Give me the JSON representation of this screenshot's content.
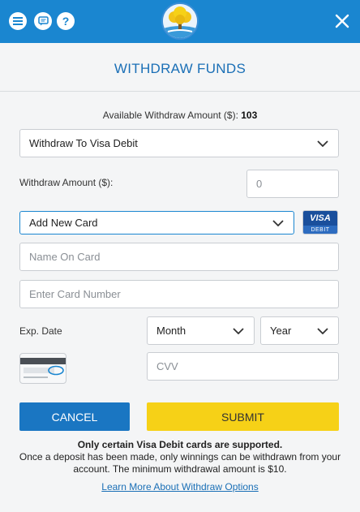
{
  "header": {
    "menu_icon": "menu-icon",
    "chat_icon": "chat-icon",
    "help_icon": "help-icon",
    "help_glyph": "?",
    "logo_icon": "tree-logo-icon",
    "close_icon": "close-icon"
  },
  "dialog": {
    "title": "WITHDRAW FUNDS",
    "available_label": "Available Withdraw Amount ($): ",
    "available_value": "103",
    "method_select": "Withdraw To Visa Debit",
    "amount_label": "Withdraw Amount ($):",
    "amount_placeholder": "0",
    "card_select": "Add New Card",
    "visa_badge_top": "VISA",
    "visa_badge_bottom": "DEBIT",
    "name_placeholder": "Name On Card",
    "card_number_placeholder": "Enter Card Number",
    "exp_label": "Exp. Date",
    "month_select": "Month",
    "year_select": "Year",
    "cvv_placeholder": "CVV",
    "cancel_label": "CANCEL",
    "submit_label": "SUBMIT",
    "notice_bold": "Only certain Visa Debit cards are supported.",
    "notice_text": "Once a deposit has been made, only winnings can be withdrawn from your account. The minimum withdrawal amount is $10.",
    "learn_more": "Learn More About Withdraw Options"
  },
  "colors": {
    "header_blue": "#1a86d0",
    "title_blue": "#1a6fb6",
    "cancel_blue": "#1a76c2",
    "submit_yellow": "#f6d117"
  }
}
